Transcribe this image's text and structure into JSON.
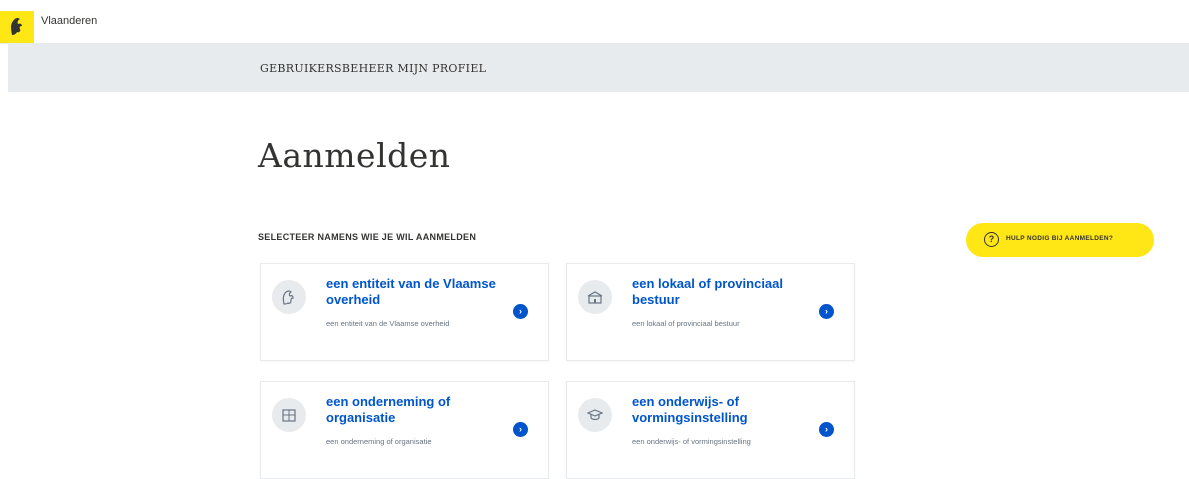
{
  "header": {
    "brand": "Vlaanderen",
    "logo_icon": "flemish-lion-icon",
    "brand_color": "#ffe615"
  },
  "nav": {
    "title": "GEBRUIKERSBEHEER MIJN PROFIEL"
  },
  "page": {
    "title": "Aanmelden",
    "section_label": "SELECTEER NAMENS WIE JE WIL AANMELDEN"
  },
  "help": {
    "icon": "question-circle-icon",
    "label": "HULP NODIG BIJ AANMELDEN?"
  },
  "cards": [
    {
      "icon": "flemish-lion-icon",
      "title": "een entiteit van de Vlaamse overheid",
      "description": "een entiteit van de Vlaamse overheid"
    },
    {
      "icon": "town-hall-icon",
      "title": "een lokaal of provinciaal bestuur",
      "description": "een lokaal of provinciaal bestuur"
    },
    {
      "icon": "building-icon",
      "title": "een onderneming of organisatie",
      "description": "een onderneming of organisatie"
    },
    {
      "icon": "graduation-cap-icon",
      "title": "een onderwijs- of vormingsinstelling",
      "description": "een onderwijs- of vormingsinstelling"
    }
  ],
  "colors": {
    "link": "#0055cc",
    "nav_background": "#e8ebee",
    "accent": "#ffe615"
  }
}
